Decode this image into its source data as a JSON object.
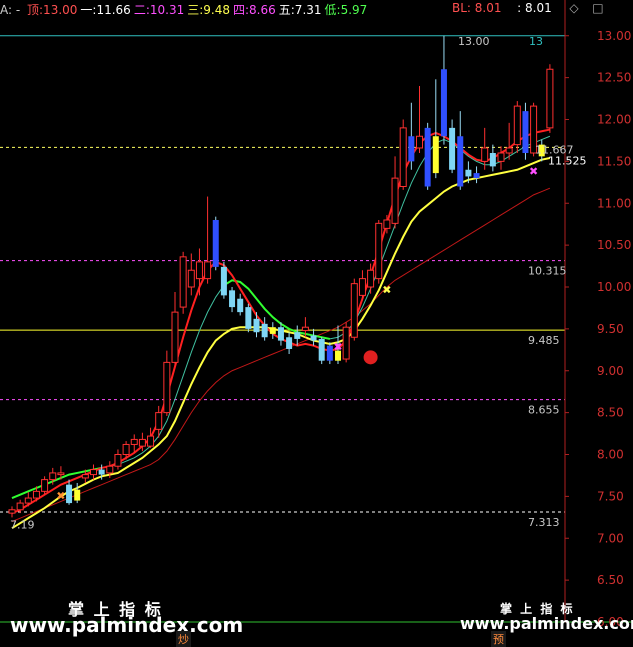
{
  "header": {
    "prefix": "A: -",
    "levels": [
      {
        "label": "顶:",
        "value": "13.00",
        "color": "#ff5050"
      },
      {
        "label": "一:",
        "value": "11.66",
        "color": "#ffffff"
      },
      {
        "label": "二:",
        "value": "10.31",
        "color": "#ff50ff"
      },
      {
        "label": "三:",
        "value": "9.48",
        "color": "#ffff50"
      },
      {
        "label": "四:",
        "value": "8.66",
        "color": "#ff50ff"
      },
      {
        "label": "五:",
        "value": "7.31",
        "color": "#ffffff"
      },
      {
        "label": "低:",
        "value": "5.97",
        "color": "#50ff50"
      }
    ],
    "right_bl_label": "BL: 8.01",
    "right_value": ": 8.01",
    "right_icons": [
      "diamond-icon",
      "box-icon"
    ]
  },
  "watermarks": {
    "main_cn": "掌 上 指 标",
    "main_url": "www.palmindex.com",
    "right_cn": "掌 上 指 标",
    "right_url": "www.palmindex.com"
  },
  "bottom_tags": [
    "炒",
    "预"
  ],
  "colors": {
    "bg": "#000000",
    "up": "#ff3030",
    "down_light": "#7fd6f5",
    "down_blue": "#3050ff",
    "yellow": "#ffff30",
    "axis": "#c03030",
    "ma_yellow": "#ffff40",
    "ma_red": "#ff2020",
    "ma_darkred": "#c01818",
    "ma_green": "#30ff30",
    "ma_cyan": "#40c0a0"
  },
  "chart_data": {
    "type": "candlestick",
    "ylim": [
      6.0,
      13.2
    ],
    "yticks": [
      "13.00",
      "12.50",
      "12.00",
      "11.50",
      "11.00",
      "10.50",
      "10.00",
      "9.50",
      "9.00",
      "8.50",
      "8.00",
      "7.50",
      "7.00",
      "6.50",
      "6.00"
    ],
    "levels": [
      {
        "value": 13.0,
        "label": "13.00",
        "color": "#30c0c0"
      },
      {
        "value": 11.667,
        "label": "11.667",
        "color": "#ffff60"
      },
      {
        "value": 10.315,
        "label": "10.315",
        "color": "#ff50ff"
      },
      {
        "value": 9.485,
        "label": "9.485",
        "color": "#ffff30"
      },
      {
        "value": 8.655,
        "label": "8.655",
        "color": "#ff50ff"
      },
      {
        "value": 7.313,
        "label": "7.313",
        "color": "#ffffff"
      }
    ],
    "annotations": [
      {
        "text": "13.00",
        "x": 44,
        "y": 13.0
      },
      {
        "text": "11.525",
        "x": 53,
        "y": 11.525
      },
      {
        "text": "7.19",
        "x": 0,
        "y": 7.19
      },
      {
        "text": "13",
        "x": 57,
        "y": 12.95
      }
    ],
    "candles": [
      {
        "o": 7.3,
        "c": 7.34,
        "h": 7.38,
        "l": 7.25,
        "k": "up"
      },
      {
        "o": 7.34,
        "c": 7.42,
        "h": 7.46,
        "l": 7.3,
        "k": "up"
      },
      {
        "o": 7.42,
        "c": 7.48,
        "h": 7.55,
        "l": 7.38,
        "k": "up"
      },
      {
        "o": 7.48,
        "c": 7.56,
        "h": 7.62,
        "l": 7.44,
        "k": "up"
      },
      {
        "o": 7.56,
        "c": 7.7,
        "h": 7.74,
        "l": 7.52,
        "k": "up"
      },
      {
        "o": 7.7,
        "c": 7.78,
        "h": 7.84,
        "l": 7.64,
        "k": "up"
      },
      {
        "o": 7.78,
        "c": 7.76,
        "h": 7.86,
        "l": 7.7,
        "k": "up"
      },
      {
        "o": 7.64,
        "c": 7.42,
        "h": 7.7,
        "l": 7.4,
        "k": "down"
      },
      {
        "o": 7.58,
        "c": 7.45,
        "h": 7.66,
        "l": 7.42,
        "k": "yellow"
      },
      {
        "o": 7.72,
        "c": 7.76,
        "h": 7.82,
        "l": 7.66,
        "k": "up"
      },
      {
        "o": 7.76,
        "c": 7.82,
        "h": 7.88,
        "l": 7.7,
        "k": "up"
      },
      {
        "o": 7.82,
        "c": 7.76,
        "h": 7.88,
        "l": 7.7,
        "k": "down"
      },
      {
        "o": 7.78,
        "c": 7.86,
        "h": 7.92,
        "l": 7.72,
        "k": "up"
      },
      {
        "o": 7.86,
        "c": 8.0,
        "h": 8.06,
        "l": 7.82,
        "k": "up"
      },
      {
        "o": 8.0,
        "c": 8.12,
        "h": 8.16,
        "l": 7.94,
        "k": "up"
      },
      {
        "o": 8.12,
        "c": 8.18,
        "h": 8.24,
        "l": 8.02,
        "k": "up"
      },
      {
        "o": 8.18,
        "c": 8.1,
        "h": 8.26,
        "l": 8.04,
        "k": "up"
      },
      {
        "o": 8.1,
        "c": 8.22,
        "h": 8.32,
        "l": 8.08,
        "k": "up"
      },
      {
        "o": 8.3,
        "c": 8.5,
        "h": 8.58,
        "l": 8.2,
        "k": "up"
      },
      {
        "o": 8.5,
        "c": 9.1,
        "h": 9.24,
        "l": 8.46,
        "k": "up"
      },
      {
        "o": 9.1,
        "c": 9.7,
        "h": 9.94,
        "l": 9.06,
        "k": "up"
      },
      {
        "o": 9.76,
        "c": 10.36,
        "h": 10.42,
        "l": 9.68,
        "k": "up"
      },
      {
        "o": 10.2,
        "c": 10.0,
        "h": 10.4,
        "l": 9.9,
        "k": "up"
      },
      {
        "o": 10.1,
        "c": 10.3,
        "h": 10.46,
        "l": 9.9,
        "k": "up"
      },
      {
        "o": 10.3,
        "c": 10.1,
        "h": 11.08,
        "l": 10.04,
        "k": "up"
      },
      {
        "o": 10.8,
        "c": 10.24,
        "h": 10.84,
        "l": 10.2,
        "k": "blue"
      },
      {
        "o": 10.24,
        "c": 9.9,
        "h": 10.3,
        "l": 9.86,
        "k": "down"
      },
      {
        "o": 9.96,
        "c": 9.76,
        "h": 10.0,
        "l": 9.7,
        "k": "down"
      },
      {
        "o": 9.86,
        "c": 9.7,
        "h": 9.92,
        "l": 9.66,
        "k": "down"
      },
      {
        "o": 9.76,
        "c": 9.5,
        "h": 9.8,
        "l": 9.46,
        "k": "down"
      },
      {
        "o": 9.62,
        "c": 9.46,
        "h": 9.7,
        "l": 9.4,
        "k": "down"
      },
      {
        "o": 9.56,
        "c": 9.4,
        "h": 9.64,
        "l": 9.36,
        "k": "down"
      },
      {
        "o": 9.52,
        "c": 9.44,
        "h": 9.58,
        "l": 9.38,
        "k": "yellow"
      },
      {
        "o": 9.52,
        "c": 9.36,
        "h": 9.58,
        "l": 9.3,
        "k": "down"
      },
      {
        "o": 9.4,
        "c": 9.26,
        "h": 9.46,
        "l": 9.2,
        "k": "down"
      },
      {
        "o": 9.46,
        "c": 9.38,
        "h": 9.54,
        "l": 9.3,
        "k": "down"
      },
      {
        "o": 9.48,
        "c": 9.52,
        "h": 9.64,
        "l": 9.4,
        "k": "up"
      },
      {
        "o": 9.42,
        "c": 9.36,
        "h": 9.5,
        "l": 9.3,
        "k": "down"
      },
      {
        "o": 9.38,
        "c": 9.12,
        "h": 9.4,
        "l": 9.08,
        "k": "down"
      },
      {
        "o": 9.3,
        "c": 9.12,
        "h": 9.34,
        "l": 9.08,
        "k": "blue"
      },
      {
        "o": 9.24,
        "c": 9.12,
        "h": 9.54,
        "l": 9.08,
        "k": "yellow"
      },
      {
        "o": 9.14,
        "c": 9.52,
        "h": 9.58,
        "l": 9.1,
        "k": "up"
      },
      {
        "o": 9.4,
        "c": 10.04,
        "h": 10.1,
        "l": 9.36,
        "k": "up"
      },
      {
        "o": 9.9,
        "c": 10.1,
        "h": 10.2,
        "l": 9.84,
        "k": "up"
      },
      {
        "o": 10.0,
        "c": 10.2,
        "h": 10.28,
        "l": 9.92,
        "k": "up"
      },
      {
        "o": 10.1,
        "c": 10.76,
        "h": 10.8,
        "l": 10.04,
        "k": "up"
      },
      {
        "o": 10.7,
        "c": 10.8,
        "h": 10.86,
        "l": 10.64,
        "k": "up"
      },
      {
        "o": 10.76,
        "c": 11.3,
        "h": 11.56,
        "l": 10.7,
        "k": "up"
      },
      {
        "o": 11.2,
        "c": 11.9,
        "h": 12.0,
        "l": 11.16,
        "k": "up"
      },
      {
        "o": 11.5,
        "c": 11.8,
        "h": 12.2,
        "l": 11.4,
        "k": "blue"
      },
      {
        "o": 11.66,
        "c": 11.8,
        "h": 12.4,
        "l": 11.6,
        "k": "up"
      },
      {
        "o": 11.9,
        "c": 11.2,
        "h": 11.96,
        "l": 11.16,
        "k": "blue"
      },
      {
        "o": 11.8,
        "c": 11.36,
        "h": 12.48,
        "l": 11.3,
        "k": "yellow"
      },
      {
        "o": 12.6,
        "c": 11.8,
        "h": 13.0,
        "l": 11.7,
        "k": "blue"
      },
      {
        "o": 11.9,
        "c": 11.4,
        "h": 12.0,
        "l": 11.36,
        "k": "down"
      },
      {
        "o": 11.8,
        "c": 11.2,
        "h": 12.1,
        "l": 11.16,
        "k": "blue"
      },
      {
        "o": 11.4,
        "c": 11.32,
        "h": 11.5,
        "l": 11.24,
        "k": "down"
      },
      {
        "o": 11.36,
        "c": 11.3,
        "h": 11.44,
        "l": 11.24,
        "k": "blue"
      },
      {
        "o": 11.5,
        "c": 11.66,
        "h": 11.9,
        "l": 11.4,
        "k": "up"
      },
      {
        "o": 11.6,
        "c": 11.44,
        "h": 11.7,
        "l": 11.38,
        "k": "down"
      },
      {
        "o": 11.5,
        "c": 11.6,
        "h": 11.68,
        "l": 11.4,
        "k": "up"
      },
      {
        "o": 11.6,
        "c": 11.66,
        "h": 11.96,
        "l": 11.52,
        "k": "up"
      },
      {
        "o": 11.7,
        "c": 12.16,
        "h": 12.22,
        "l": 11.6,
        "k": "up"
      },
      {
        "o": 12.1,
        "c": 11.6,
        "h": 12.2,
        "l": 11.52,
        "k": "blue"
      },
      {
        "o": 11.6,
        "c": 12.16,
        "h": 12.2,
        "l": 11.56,
        "k": "up"
      },
      {
        "o": 11.7,
        "c": 11.56,
        "h": 11.76,
        "l": 11.5,
        "k": "yellow"
      },
      {
        "o": 11.9,
        "c": 12.6,
        "h": 12.66,
        "l": 11.84,
        "k": "up"
      }
    ],
    "ma_yellow": [
      7.12,
      7.18,
      7.24,
      7.3,
      7.36,
      7.43,
      7.5,
      7.56,
      7.6,
      7.65,
      7.7,
      7.74,
      7.76,
      7.78,
      7.84,
      7.9,
      7.96,
      8.04,
      8.12,
      8.22,
      8.4,
      8.62,
      8.84,
      9.04,
      9.22,
      9.36,
      9.44,
      9.5,
      9.52,
      9.52,
      9.52,
      9.52,
      9.5,
      9.48,
      9.46,
      9.44,
      9.4,
      9.36,
      9.34,
      9.32,
      9.34,
      9.38,
      9.48,
      9.62,
      9.78,
      9.96,
      10.18,
      10.4,
      10.6,
      10.78,
      10.9,
      10.98,
      11.06,
      11.14,
      11.2,
      11.24,
      11.28,
      11.3,
      11.32,
      11.34,
      11.36,
      11.38,
      11.4,
      11.44,
      11.48,
      11.52,
      11.54
    ],
    "ma_red": [
      7.3,
      7.34,
      7.4,
      7.46,
      7.52,
      7.58,
      7.64,
      7.68,
      7.72,
      7.76,
      7.8,
      7.84,
      7.86,
      7.9,
      7.96,
      8.02,
      8.1,
      8.2,
      8.4,
      8.7,
      9.05,
      9.4,
      9.72,
      10.0,
      10.2,
      10.3,
      10.26,
      10.14,
      9.98,
      9.82,
      9.66,
      9.54,
      9.44,
      9.38,
      9.34,
      9.3,
      9.32,
      9.3,
      9.26,
      9.24,
      9.26,
      9.36,
      9.58,
      9.86,
      10.14,
      10.44,
      10.76,
      11.08,
      11.36,
      11.56,
      11.72,
      11.8,
      11.84,
      11.8,
      11.74,
      11.66,
      11.58,
      11.52,
      11.5,
      11.54,
      11.6,
      11.66,
      11.74,
      11.8,
      11.84,
      11.86,
      11.88
    ],
    "ma_darkred": [
      7.2,
      7.24,
      7.28,
      7.32,
      7.36,
      7.4,
      7.44,
      7.48,
      7.52,
      7.56,
      7.6,
      7.64,
      7.68,
      7.72,
      7.76,
      7.8,
      7.84,
      7.88,
      7.94,
      8.04,
      8.18,
      8.34,
      8.5,
      8.64,
      8.76,
      8.86,
      8.94,
      9.0,
      9.04,
      9.08,
      9.12,
      9.16,
      9.2,
      9.24,
      9.28,
      9.32,
      9.36,
      9.4,
      9.44,
      9.48,
      9.52,
      9.58,
      9.64,
      9.72,
      9.8,
      9.9,
      10.0,
      10.08,
      10.14,
      10.2,
      10.26,
      10.32,
      10.38,
      10.44,
      10.5,
      10.56,
      10.62,
      10.68,
      10.74,
      10.8,
      10.86,
      10.92,
      10.98,
      11.04,
      11.1,
      11.14,
      11.18
    ],
    "ma_green_cyan": [
      7.48,
      7.52,
      7.56,
      7.6,
      7.64,
      7.68,
      7.72,
      7.76,
      7.78,
      7.8,
      7.82,
      7.84,
      7.86,
      7.88,
      7.92,
      7.96,
      8.02,
      8.1,
      8.22,
      8.4,
      8.66,
      8.94,
      9.22,
      9.48,
      9.7,
      9.88,
      10.02,
      10.08,
      10.06,
      9.98,
      9.86,
      9.74,
      9.64,
      9.56,
      9.5,
      9.46,
      9.44,
      9.42,
      9.4,
      9.38,
      9.4,
      9.46,
      9.58,
      9.76,
      9.98,
      10.22,
      10.48,
      10.74,
      11.0,
      11.24,
      11.44,
      11.6,
      11.72,
      11.76,
      11.72,
      11.64,
      11.56,
      11.5,
      11.46,
      11.46,
      11.5,
      11.56,
      11.62,
      11.68,
      11.72,
      11.76,
      11.8
    ]
  }
}
